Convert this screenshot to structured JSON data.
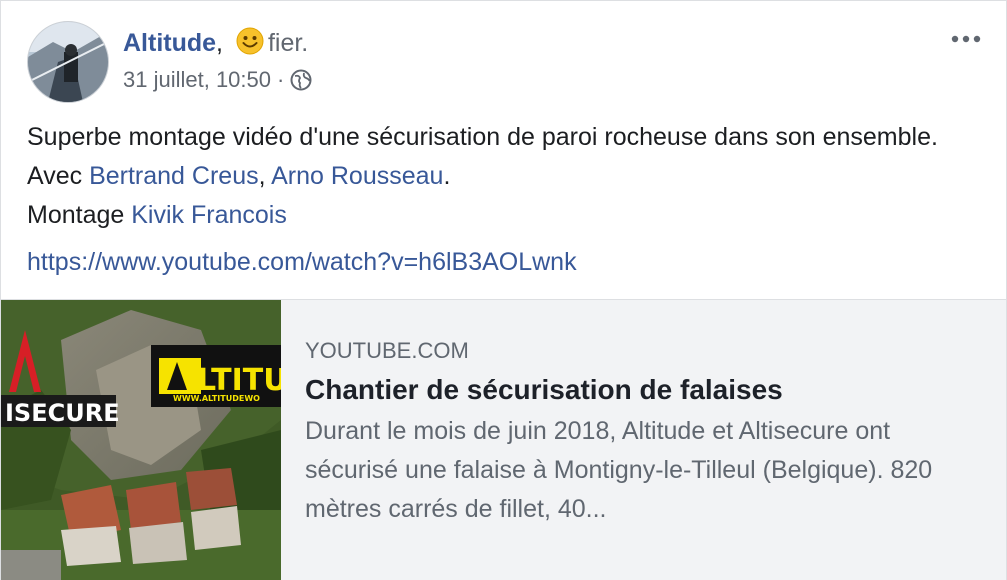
{
  "post": {
    "author": "Altitude",
    "author_suffix": ",",
    "feeling": "fier.",
    "timestamp": "31 juillet, 10:50",
    "separator": "·",
    "privacy_icon": "globe-icon",
    "more_icon": "more-horizontal-icon",
    "text": {
      "line1": "Superbe montage vidéo d'une sécurisation de paroi rocheuse dans son ensemble. Avec ",
      "mention1": "Bertrand Creus",
      "sep1": ", ",
      "mention2": "Arno Rousseau",
      "end1": ".",
      "line2_prefix": "Montage ",
      "mention3": "Kivik Francois"
    },
    "url": "https://www.youtube.com/watch?v=h6lB3AOLwnk"
  },
  "link_preview": {
    "domain": "YOUTUBE.COM",
    "title": "Chantier de sécurisation de falaises",
    "description": "Durant le mois de juin 2018, Altitude et Altisecure ont sécurisé une falaise à Montigny-le-Tilleul (Belgique). 820 mètres carrés de fillet, 40...",
    "thumbnail": {
      "logo_left_text": "ISECURE",
      "logo_right_text": "LTITU",
      "logo_right_small": "WWW.ALTITUDEWO"
    }
  },
  "colors": {
    "link": "#385898",
    "secondary": "#616770",
    "card_bg": "#f2f3f5",
    "logo_yellow": "#f6e300",
    "logo_red": "#d71f26"
  }
}
